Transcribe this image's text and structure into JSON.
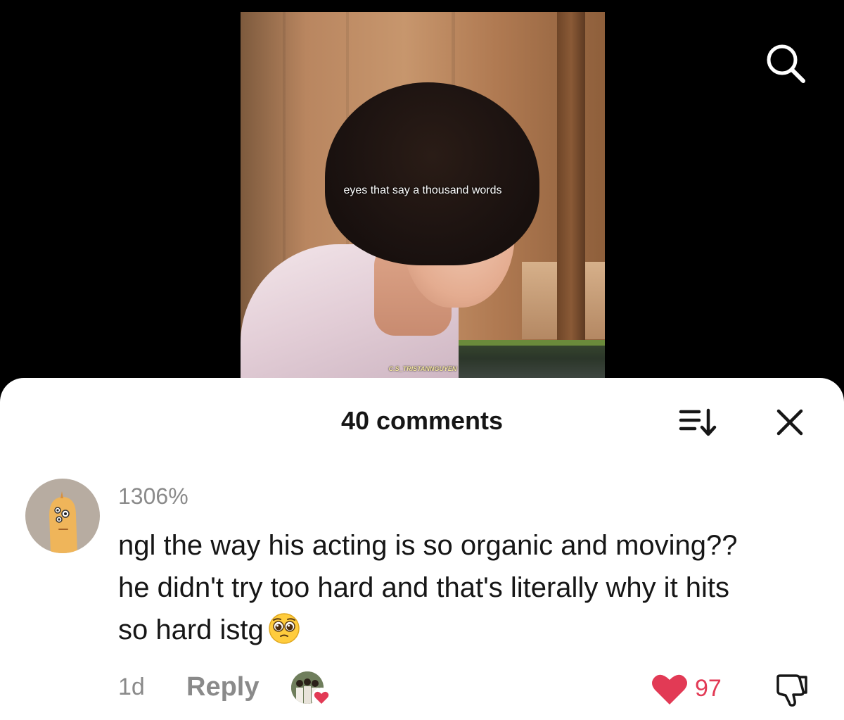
{
  "video": {
    "subtitle": "eyes that say a thousand words",
    "watermark": "C.S_TRISTANNGUYEN"
  },
  "icons": {
    "search": "search-icon",
    "sort": "sort-icon",
    "close": "close-icon",
    "like": "heart-icon",
    "dislike": "dislike-icon",
    "emoji": "pleading-face-emoji"
  },
  "comments_sheet": {
    "title": "40 comments"
  },
  "comment": {
    "username": "1306%",
    "text": "ngl the way his acting is so organic and moving?? he didn't try too hard and that's literally why it hits so hard istg",
    "timestamp": "1d",
    "reply_label": "Reply",
    "like_count": "97",
    "liked_by_creator": true
  },
  "colors": {
    "accent_like": "#e23a55",
    "secondary_text": "#8a8a8a",
    "primary_text": "#161616"
  }
}
